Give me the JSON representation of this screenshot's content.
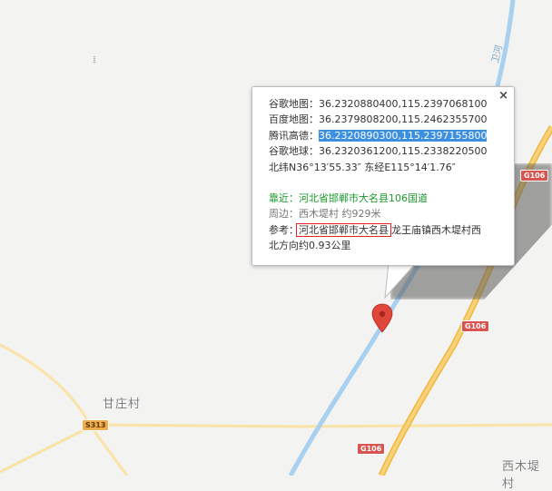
{
  "map": {
    "place_labels": [
      {
        "text": "甘庄村"
      },
      {
        "text": "西木堤村"
      }
    ],
    "road_shields": [
      {
        "text": "G106",
        "kind": "national"
      },
      {
        "text": "G106",
        "kind": "national"
      },
      {
        "text": "G106",
        "kind": "national"
      },
      {
        "text": "S313",
        "kind": "provincial"
      }
    ],
    "water_label": "卫河",
    "colors": {
      "background": "#f3f3f1",
      "river": "#a8d0f0",
      "national_road": "#f6c453",
      "minor_road": "#fbe3a8",
      "marker": "#e0463a"
    }
  },
  "popup": {
    "close_glyph": "×",
    "rows": {
      "google_map": {
        "label": "谷歌地图：",
        "value": "36.2320880400,115.2397068100"
      },
      "baidu_map": {
        "label": "百度地图：",
        "value": "36.2379808200,115.2462355700"
      },
      "tencent_gaode": {
        "label": "腾讯高德：",
        "value": "36.2320890300,115.2397155800"
      },
      "google_earth": {
        "label": "谷歌地球：",
        "value": "36.2320361200,115.2338220500"
      },
      "dms": "北纬N36°13′55.33″ 东经E115°14′1.76″"
    },
    "near": "靠近：河北省邯郸市大名县106国道",
    "around": "周边：西木堤村 约929米",
    "reference": {
      "label": "参考：",
      "boxed": "河北省邯郸市大名县",
      "rest": "龙王庙镇西木堤村西",
      "line2": "北方向约0.93公里"
    }
  }
}
